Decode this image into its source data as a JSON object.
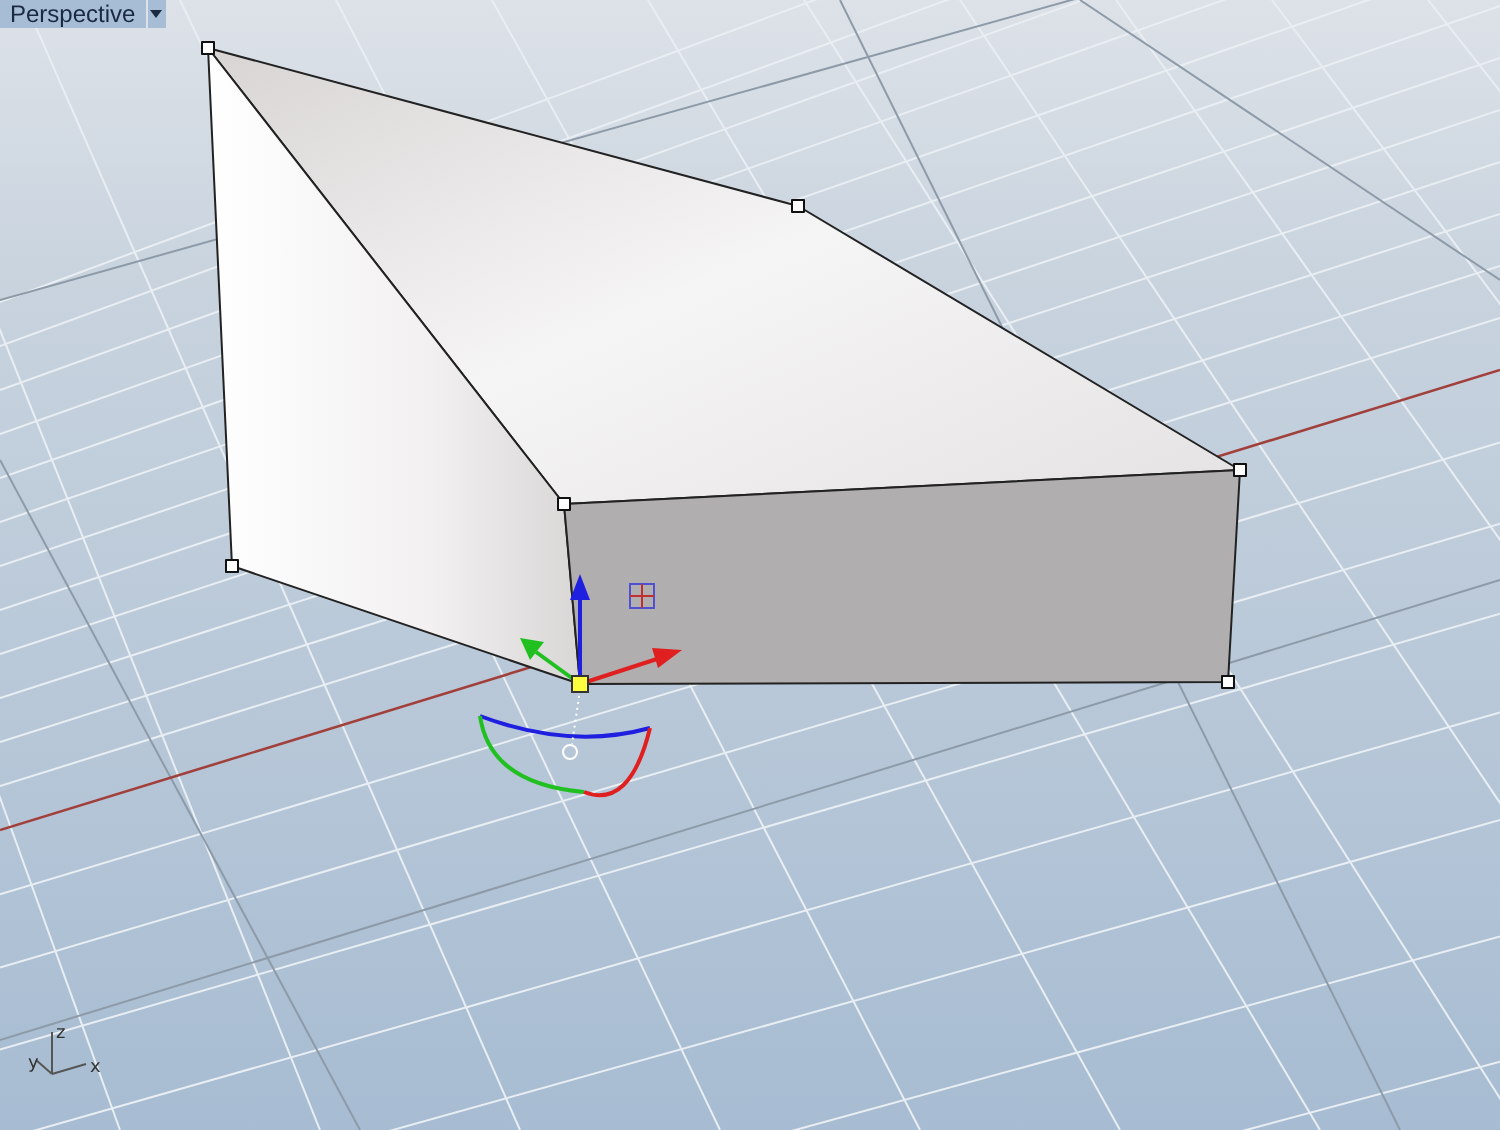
{
  "viewport": {
    "title": "Perspective",
    "axes": [
      {
        "kind": "z",
        "label": "z"
      },
      {
        "kind": "y",
        "label": "y"
      },
      {
        "kind": "x",
        "label": "x"
      }
    ]
  }
}
